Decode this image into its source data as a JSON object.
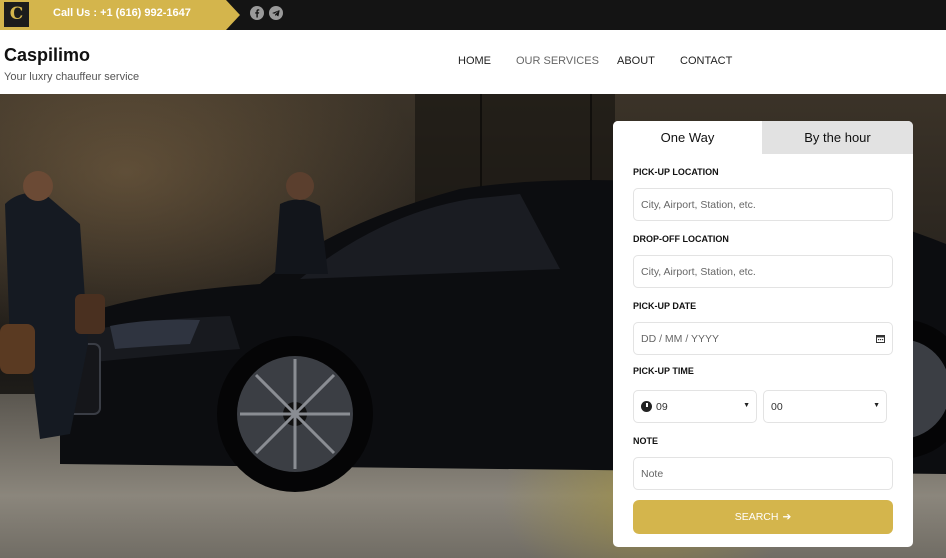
{
  "topbar": {
    "logo_text": "C",
    "call_text": "Call Us : +1 (616) 992-1647",
    "social": [
      {
        "icon": "facebook-icon"
      },
      {
        "icon": "telegram-icon"
      }
    ]
  },
  "header": {
    "brand": "Caspilimo",
    "tagline": "Your luxry chauffeur service",
    "nav": [
      "HOME",
      "OUR SERVICES",
      "ABOUT",
      "CONTACT"
    ]
  },
  "booking": {
    "tabs": [
      "One Way",
      "By the hour"
    ],
    "pickup_label": "PICK-UP LOCATION",
    "pickup_placeholder": "City, Airport, Station, etc.",
    "dropoff_label": "DROP-OFF LOCATION",
    "dropoff_placeholder": "City, Airport, Station, etc.",
    "date_label": "PICK-UP DATE",
    "date_placeholder": "DD / MM / YYYY",
    "time_label": "PICK-UP TIME",
    "hour_value": "09",
    "minute_value": "00",
    "note_label": "NOTE",
    "note_placeholder": "Note",
    "search_label": "SEARCH",
    "search_arrow": "➔"
  },
  "colors": {
    "accent": "#d4b54c",
    "topbar_bg": "#141414"
  }
}
